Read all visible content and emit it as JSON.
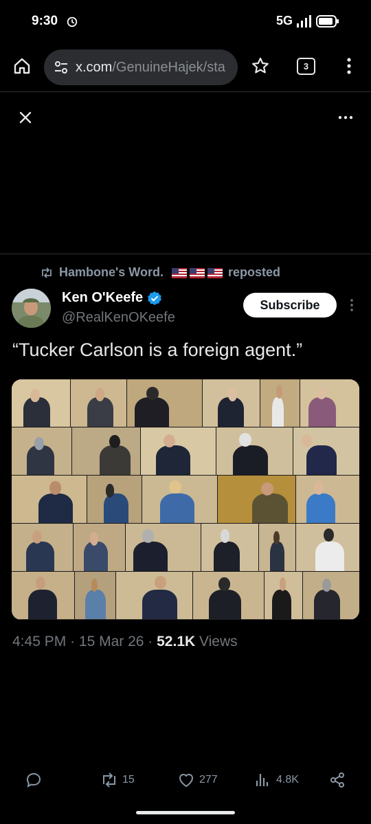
{
  "status_bar": {
    "time": "9:30",
    "network": "5G"
  },
  "browser": {
    "url_host": "x.com",
    "url_path": "/GenuineHajek/sta",
    "tab_count": "3"
  },
  "repost": {
    "text": "Hambone's Word.",
    "suffix": "reposted"
  },
  "author": {
    "name": "Ken O'Keefe",
    "handle": "@RealKenOKeefe"
  },
  "subscribe_label": "Subscribe",
  "tweet": {
    "text": "“Tucker Carlson is a foreign agent.”"
  },
  "meta": {
    "time": "4:45 PM",
    "date": "15 Mar 26",
    "views_count": "52.1K",
    "views_label": "Views"
  },
  "actions": {
    "reposts": "15",
    "likes": "277",
    "views": "4.8K"
  },
  "colors": {
    "accent": "#1d9bf0",
    "background": "#000000",
    "muted": "#71767b"
  }
}
